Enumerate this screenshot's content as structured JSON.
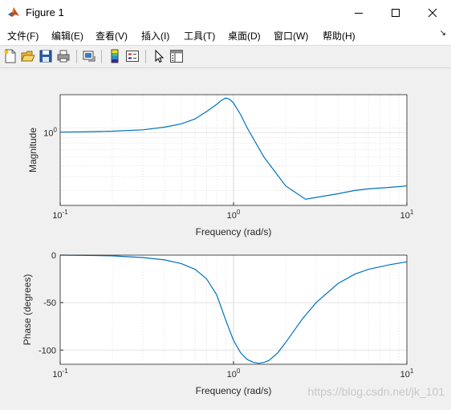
{
  "window": {
    "title": "Figure 1"
  },
  "menu": {
    "items": [
      "文件(F)",
      "编辑(E)",
      "查看(V)",
      "插入(I)",
      "工具(T)",
      "桌面(D)",
      "窗口(W)",
      "帮助(H)"
    ]
  },
  "toolbar": {
    "icons": [
      "new-figure-icon",
      "open-file-icon",
      "save-icon",
      "print-icon",
      "link-plot-icon",
      "colorbar-icon",
      "legend-icon",
      "pointer-icon",
      "property-inspector-icon"
    ]
  },
  "chart_data": [
    {
      "type": "line",
      "xlabel": "Frequency (rad/s)",
      "ylabel": "Magnitude",
      "xscale": "log",
      "yscale": "log",
      "xlim": [
        0.1,
        10
      ],
      "x_ticks": [
        {
          "base": "10",
          "exp": "-1"
        },
        {
          "base": "10",
          "exp": "0"
        },
        {
          "base": "10",
          "exp": "1"
        }
      ],
      "y_ticks": [
        {
          "base": "10",
          "exp": "0"
        }
      ],
      "grid": true,
      "color": "#0072bd",
      "series": [
        {
          "x": [
            0.1,
            0.15,
            0.2,
            0.3,
            0.4,
            0.5,
            0.6,
            0.7,
            0.8,
            0.85,
            0.9,
            0.95,
            1.0,
            1.1,
            1.2,
            1.5,
            2.0,
            2.6,
            3.0,
            4.0,
            5.0,
            6.0,
            8.0,
            10.0
          ],
          "y": [
            1.01,
            1.02,
            1.03,
            1.06,
            1.12,
            1.2,
            1.33,
            1.55,
            1.8,
            1.95,
            2.05,
            2.0,
            1.85,
            1.45,
            1.1,
            0.6,
            0.33,
            0.25,
            0.26,
            0.28,
            0.3,
            0.31,
            0.32,
            0.33
          ]
        }
      ]
    },
    {
      "type": "line",
      "xlabel": "Frequency (rad/s)",
      "ylabel": "Phase (degrees)",
      "xscale": "log",
      "xlim": [
        0.1,
        10
      ],
      "ylim": [
        -115,
        0
      ],
      "x_ticks": [
        {
          "base": "10",
          "exp": "-1"
        },
        {
          "base": "10",
          "exp": "0"
        },
        {
          "base": "10",
          "exp": "1"
        }
      ],
      "y_ticks": [
        "0",
        "-50",
        "-100"
      ],
      "grid": true,
      "color": "#0072bd",
      "series": [
        {
          "x": [
            0.1,
            0.15,
            0.2,
            0.3,
            0.4,
            0.5,
            0.6,
            0.7,
            0.8,
            0.9,
            1.0,
            1.1,
            1.2,
            1.3,
            1.4,
            1.5,
            1.6,
            1.8,
            2.0,
            2.5,
            3.0,
            4.0,
            5.0,
            6.0,
            8.0,
            10.0
          ],
          "y": [
            0,
            -0.3,
            -0.8,
            -2.5,
            -5,
            -9,
            -15,
            -25,
            -42,
            -68,
            -90,
            -103,
            -110,
            -113,
            -114,
            -113,
            -111,
            -103,
            -92,
            -67,
            -50,
            -30,
            -20,
            -15,
            -10,
            -7
          ]
        }
      ]
    }
  ],
  "watermark": "https://blog.csdn.net/jk_101"
}
